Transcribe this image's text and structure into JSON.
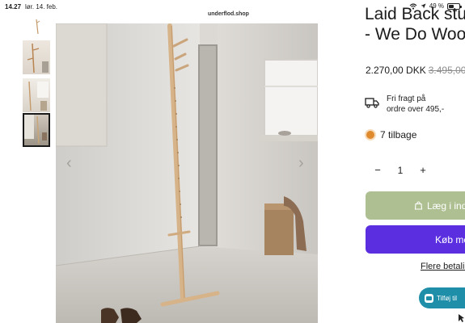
{
  "status_bar": {
    "time": "14.27",
    "date": "lør. 14. feb.",
    "battery_text": "49 %",
    "battery_level": 0.49,
    "icons": [
      "wifi-icon",
      "location-icon",
      "battery-icon"
    ]
  },
  "browser": {
    "url": "underflod.shop"
  },
  "gallery": {
    "thumbnails": 4,
    "selected_index": 3,
    "prev_label": "‹",
    "next_label": "›"
  },
  "product": {
    "title_line1": "Laid Back stu",
    "title_line2": "- We Do Woo",
    "price": "2.270,00 DKK",
    "price_old": "3.495,00",
    "shipping_line1": "Fri fragt på",
    "shipping_line2": "ordre over 495,-",
    "stock_text": "7 tilbage",
    "stock_color": "#e08a2e",
    "quantity": "1",
    "qty_minus": "−",
    "qty_plus": "+",
    "add_to_cart": "Læg i ind",
    "buy_now": "Køb me",
    "more_payment": "Flere betalin"
  },
  "floating": {
    "add_label": "Tilføj til"
  },
  "colors": {
    "add_to_cart_bg": "#aebf92",
    "buy_now_bg": "#5b2fe0",
    "floating_bg": "#1f8ea8"
  }
}
